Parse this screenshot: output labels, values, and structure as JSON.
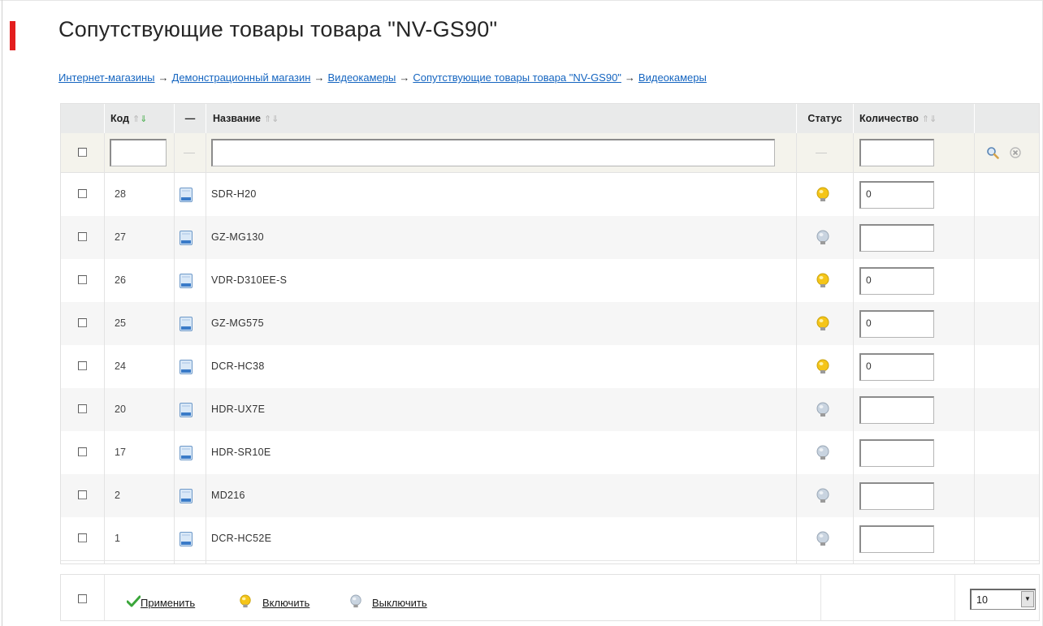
{
  "page": {
    "title": "Сопутствующие товары товара \"NV-GS90\""
  },
  "breadcrumb": [
    {
      "label": "Интернет-магазины"
    },
    {
      "label": "Демонстрационный магазин"
    },
    {
      "label": "Видеокамеры"
    },
    {
      "label": "Сопутствующие товары товара \"NV-GS90\""
    },
    {
      "label": "Видеокамеры"
    }
  ],
  "breadcrumb_separator": "→",
  "table": {
    "headers": {
      "code": "Код",
      "dash": "—",
      "name": "Название",
      "status": "Статус",
      "quantity": "Количество"
    },
    "sort_arrows": "⇑⇓",
    "filter": {
      "code_value": "",
      "name_value": "",
      "quantity_value": "",
      "dash": "—"
    },
    "rows": [
      {
        "code": "28",
        "name": "SDR-H20",
        "active": true,
        "quantity": "0"
      },
      {
        "code": "27",
        "name": "GZ-MG130",
        "active": false,
        "quantity": ""
      },
      {
        "code": "26",
        "name": "VDR-D310EE-S",
        "active": true,
        "quantity": "0"
      },
      {
        "code": "25",
        "name": "GZ-MG575",
        "active": true,
        "quantity": "0"
      },
      {
        "code": "24",
        "name": "DCR-HC38",
        "active": true,
        "quantity": "0"
      },
      {
        "code": "20",
        "name": "HDR-UX7E",
        "active": false,
        "quantity": ""
      },
      {
        "code": "17",
        "name": "HDR-SR10E",
        "active": false,
        "quantity": ""
      },
      {
        "code": "2",
        "name": "MD216",
        "active": false,
        "quantity": ""
      },
      {
        "code": "1",
        "name": "DCR-HC52E",
        "active": false,
        "quantity": ""
      }
    ]
  },
  "footer": {
    "apply_label": "Применить",
    "enable_label": "Включить",
    "disable_label": "Выключить",
    "page_size": "10"
  },
  "colors": {
    "accent_red": "#e31e1e",
    "link_blue": "#1565c0",
    "bulb_on": "#f5c518",
    "bulb_off": "#c9d4e0",
    "check_green": "#3aa63a"
  },
  "icons": {
    "row_item": "document-icon",
    "status_on": "bulb-on-icon",
    "status_off": "bulb-off-icon",
    "filter_search": "search-icon",
    "filter_clear": "clear-filter-icon",
    "apply": "checkmark-icon",
    "dropdown": "chevron-down-icon"
  }
}
